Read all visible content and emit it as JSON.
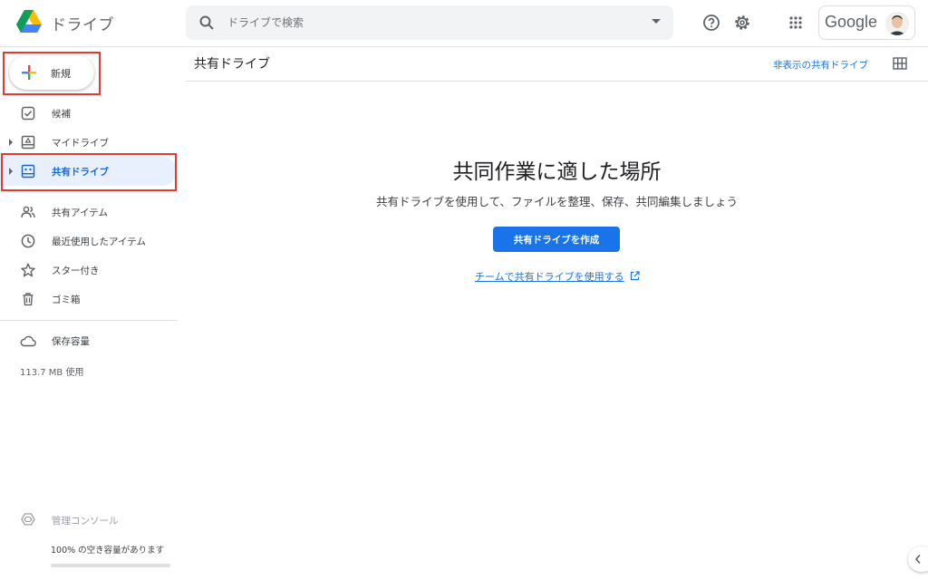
{
  "app": {
    "name": "ドライブ"
  },
  "search": {
    "placeholder": "ドライブで検索"
  },
  "account": {
    "brand": "Google"
  },
  "sidebar": {
    "new_label": "新規",
    "items": [
      {
        "label": "候補",
        "icon": "suggested-icon"
      },
      {
        "label": "マイドライブ",
        "icon": "my-drive-icon"
      },
      {
        "label": "共有ドライブ",
        "icon": "shared-drives-icon"
      },
      {
        "label": "共有アイテム",
        "icon": "people-icon"
      },
      {
        "label": "最近使用したアイテム",
        "icon": "clock-icon"
      },
      {
        "label": "スター付き",
        "icon": "star-icon"
      },
      {
        "label": "ゴミ箱",
        "icon": "trash-icon"
      },
      {
        "label": "保存容量",
        "icon": "cloud-icon"
      }
    ],
    "storage_used": "113.7 MB 使用",
    "admin_label": "管理コンソール",
    "free_space": "100% の空き容量があります"
  },
  "main": {
    "title": "共有ドライブ",
    "hidden_link": "非表示の共有ドライブ",
    "empty_title": "共同作業に適した場所",
    "empty_subtitle": "共有ドライブを使用して、ファイルを整理、保存、共同編集しましょう",
    "create_button": "共有ドライブを作成",
    "team_link": "チームで共有ドライブを使用する"
  },
  "colors": {
    "accent": "#1a73e8",
    "active_bg": "#e8f0fe",
    "highlight": "#e53935"
  }
}
